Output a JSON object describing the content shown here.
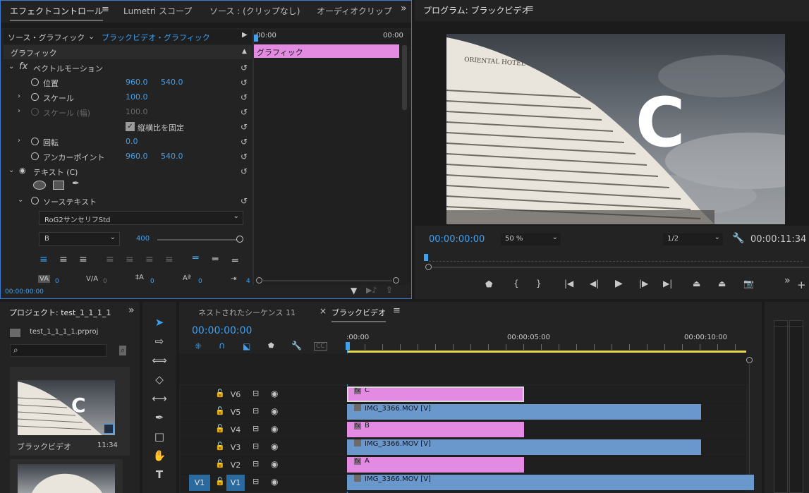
{
  "effect_panel": {
    "tabs": [
      "エフェクトコントロール",
      "Lumetri スコープ",
      "ソース : (クリップなし)",
      "オーディオクリップ"
    ],
    "menu_icon": "hamburger-icon",
    "overflow": "»",
    "source_label": "ソース・グラフィック",
    "target_label": "ブラックビデオ・グラフィック",
    "time_start": "00:00",
    "time_end": "00:00",
    "graphic_section": "グラフィック",
    "clip_bar_label": "グラフィック",
    "vector_motion": "ベクトルモーション",
    "position": {
      "label": "位置",
      "x": "960.0",
      "y": "540.0"
    },
    "scale": {
      "label": "スケール",
      "value": "100.0"
    },
    "scale_width": {
      "label": "スケール (幅)",
      "value": "100.0"
    },
    "uniform_scale": "縦横比を固定",
    "rotation": {
      "label": "回転",
      "value": "0.0"
    },
    "anchor": {
      "label": "アンカーポイント",
      "x": "960.0",
      "y": "540.0"
    },
    "text_layer": "テキスト (C)",
    "source_text": "ソーステキスト",
    "font": "RoG2サンセリフStd",
    "font_style": "B",
    "font_size": "400",
    "kern_values": [
      "0",
      "0",
      "0",
      "0",
      "4"
    ],
    "timecode": "00:00:00:00"
  },
  "program_monitor": {
    "title": "プログラム: ブラックビデオ",
    "hotel_sign": "ORIENTAL HOTEL",
    "overlay_letter": "C",
    "timecode": "00:00:00:00",
    "zoom": "50 %",
    "resolution": "1/2",
    "duration": "00:00:11:34",
    "playback_position": 0.0
  },
  "project_panel": {
    "title": "プロジェクト: test_1_1_1_1",
    "overflow": "»",
    "file": "test_1_1_1_1.prproj",
    "search_placeholder": "",
    "thumb_letter": "C",
    "clip_name": "ブラックビデオ",
    "clip_duration": "11:34"
  },
  "timeline": {
    "tab_inactive": "ネストされたシーケンス 11",
    "close": "×",
    "tab_active": "ブラックビデオ",
    "timecode": "00:00:00:00",
    "ruler": [
      ":00:00",
      "00:00:05:00",
      "00:00:10:00"
    ],
    "tracks": [
      {
        "name": "V6",
        "clip": "C",
        "kind": "graphic",
        "start": 0,
        "end": 5.0,
        "selected": true
      },
      {
        "name": "V5",
        "clip": "IMG_3366.MOV [V]",
        "kind": "video",
        "start": 0,
        "end": 10.0
      },
      {
        "name": "V4",
        "clip": "B",
        "kind": "graphic",
        "start": 0,
        "end": 5.0
      },
      {
        "name": "V3",
        "clip": "IMG_3366.MOV [V]",
        "kind": "video",
        "start": 0,
        "end": 10.0
      },
      {
        "name": "V2",
        "clip": "A",
        "kind": "graphic",
        "start": 0,
        "end": 5.0
      },
      {
        "name": "V1",
        "clip": "IMG_3366.MOV [V]",
        "kind": "video",
        "start": 0,
        "end": 11.5,
        "source": "V1"
      }
    ]
  },
  "colors": {
    "accent": "#3ea1f2",
    "graphic_clip": "#e38ae3",
    "video_clip": "#6b98cc",
    "panel": "#232323",
    "work_area": "#e5d84a"
  }
}
